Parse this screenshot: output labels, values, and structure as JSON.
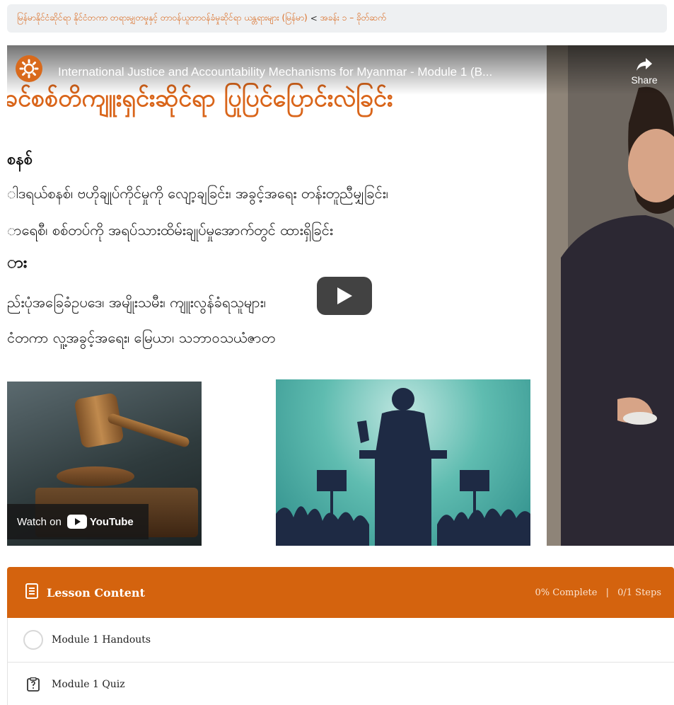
{
  "breadcrumb": {
    "course": "မြန်မာနိုင်ငံဆိုင်ရာ နိုင်ငံတကာ တရားမျှတမှုနှင့် တာဝန်ယူတာဝန်ခံမှုဆိုင်ရာ ယန္တရားများ (မြန်မာ)",
    "separator": "<",
    "current": "အခန်း ၁ – ခိုတ်ဆက်"
  },
  "video": {
    "title": "International Justice and Accountability Mechanisms for Myanmar - Module 1 (B...",
    "share_label": "Share",
    "watch_on_label": "Watch on",
    "youtube_label": "YouTube",
    "slide": {
      "title": "ခင်စစ်တိကျူးရှင်းဆိုင်ရာ ပြုပြင်ပြောင်းလဲခြင်း",
      "heading1": "စနစ်",
      "line1": "ါဒရယ်စနစ်၊ ဗဟိုချုပ်ကိုင်မှုကို လျော့ချခြင်း၊ အခွင့်အရေး တန်းတူညီမျှခြင်း၊",
      "line2": "ာရေစီ၊ စစ်တပ်ကို အရပ်သားထိမ်းချုပ်မှုအောက်တွင် ထားရှိခြင်း",
      "heading2": "ား",
      "line3": "ည်းပုံအခြေခံဥပဒေ၊ အမျိုးသမီး၊ ကျူးလွန်ခံရသူများ၊",
      "line4": "ငံတကာ လူ့အခွင့်အရေး၊ မြေယာ၊ သဘာဝသယံဇာတ"
    }
  },
  "lesson": {
    "header_title": "Lesson Content",
    "progress": "0% Complete",
    "steps": "0/1 Steps",
    "items": [
      {
        "label": "Module 1 Handouts",
        "icon": "circle-icon"
      },
      {
        "label": "Module 1 Quiz",
        "icon": "quiz-icon"
      }
    ]
  },
  "colors": {
    "accent": "#d4630e",
    "breadcrumb_link": "#d9691e"
  }
}
